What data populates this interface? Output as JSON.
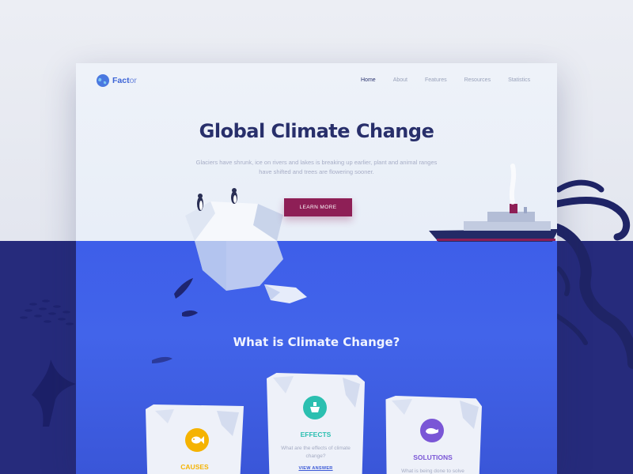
{
  "nav": {
    "logo_bold": "Fact",
    "logo_light": "or",
    "links": [
      "Home",
      "About",
      "Features",
      "Resources",
      "Statistics"
    ]
  },
  "hero": {
    "title": "Global Climate Change",
    "subtitle": "Glaciers have shrunk, ice on rivers and lakes is breaking up earlier, plant and animal ranges have shifted and trees are flowering sooner.",
    "cta": "LEARN MORE"
  },
  "section": {
    "title": "What is Climate Change?"
  },
  "cards": {
    "causes": {
      "title": "CAUSES",
      "color": "#f5b301"
    },
    "effects": {
      "title": "EFFECTS",
      "text": "What are the effects of climate change?",
      "link": "VIEW ANSWER",
      "color": "#2bbfb0"
    },
    "solutions": {
      "title": "SOLUTIONS",
      "text": "What is being done to solve",
      "color": "#7a56d6"
    }
  },
  "colors": {
    "accent": "#8e1f56",
    "title_navy": "#282f6b",
    "sea_blue": "#4264ea",
    "deep_sea": "#262b7c"
  }
}
